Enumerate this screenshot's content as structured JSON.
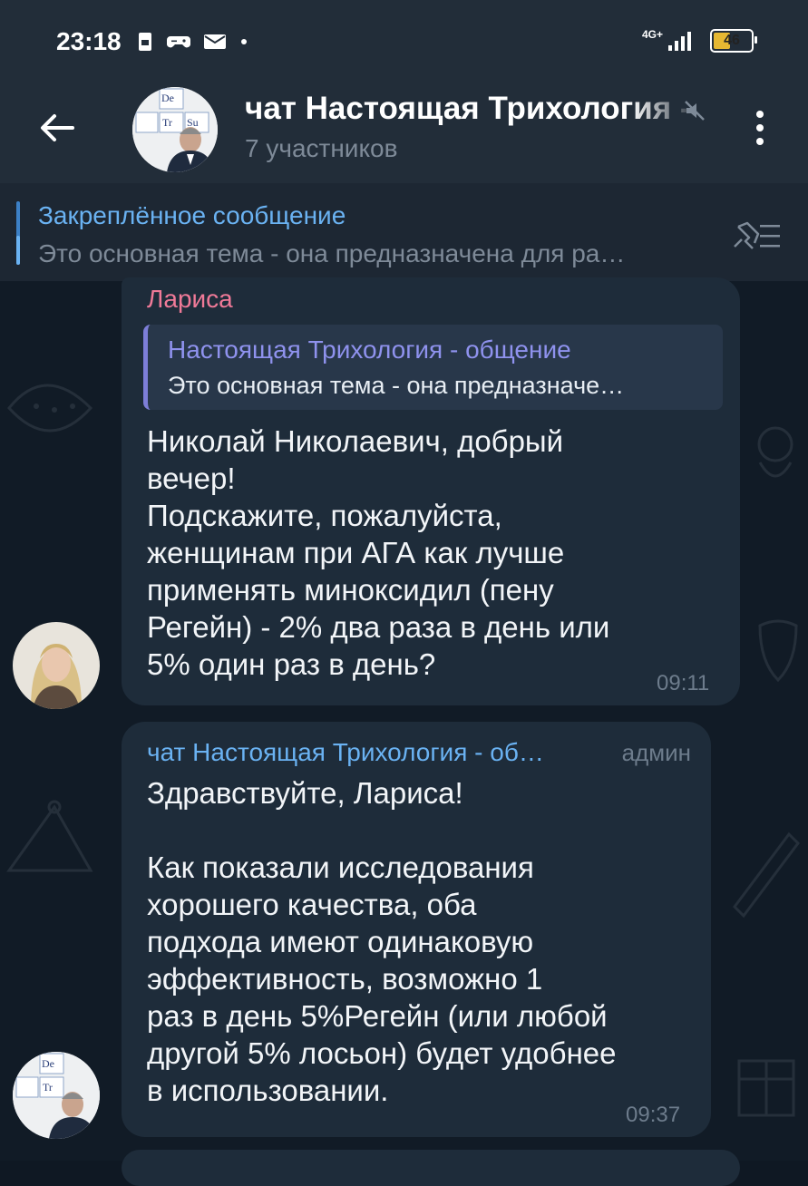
{
  "status_bar": {
    "time": "23:18",
    "network": "4G+",
    "battery": "46"
  },
  "header": {
    "title": "чат Настоящая Трихология - общение",
    "subtitle": "7 участников",
    "avatar_labels": [
      "De",
      "Tr",
      "Su"
    ]
  },
  "pinned": {
    "title": "Закреплённое сообщение",
    "text": "Это основная тема - она предназначена для ра…"
  },
  "messages": [
    {
      "sender": "Лариса",
      "sender_color": "#f07a98",
      "reply": {
        "title": "Настоящая Трихология - общение",
        "text": "Это основная тема - она предназначе…"
      },
      "text": "Николай Николаевич, добрый\nвечер!\nПодскажите, пожалуйста,\nженщинам при АГА как лучше\nприменять миноксидил (пену\nРегейн) -  2% два раза в день или\n5% один раз в день?",
      "time": "09:11"
    },
    {
      "sender": "чат Настоящая Трихология - об…",
      "sender_color": "#6ab2f2",
      "badge": "админ",
      "text": "Здравствуйте, Лариса!\n\nКак показали исследования\nхорошего качества, оба\nподхода имеют одинаковую\nэффективность, возможно 1\nраз в день 5%Регейн (или любой\nдругой 5% лосьон) будет удобнее\nв использовании.",
      "time": "09:37"
    }
  ],
  "colors": {
    "bg": "#0f1823",
    "bar": "#222d39",
    "bubble": "#1e2c3a",
    "accent": "#6ab2f2"
  },
  "icons": [
    "back-arrow-icon",
    "mute-icon",
    "more-vert-icon",
    "pin-list-icon",
    "sim-icon",
    "gamepad-icon",
    "mail-icon",
    "signal-icon",
    "battery-icon"
  ]
}
